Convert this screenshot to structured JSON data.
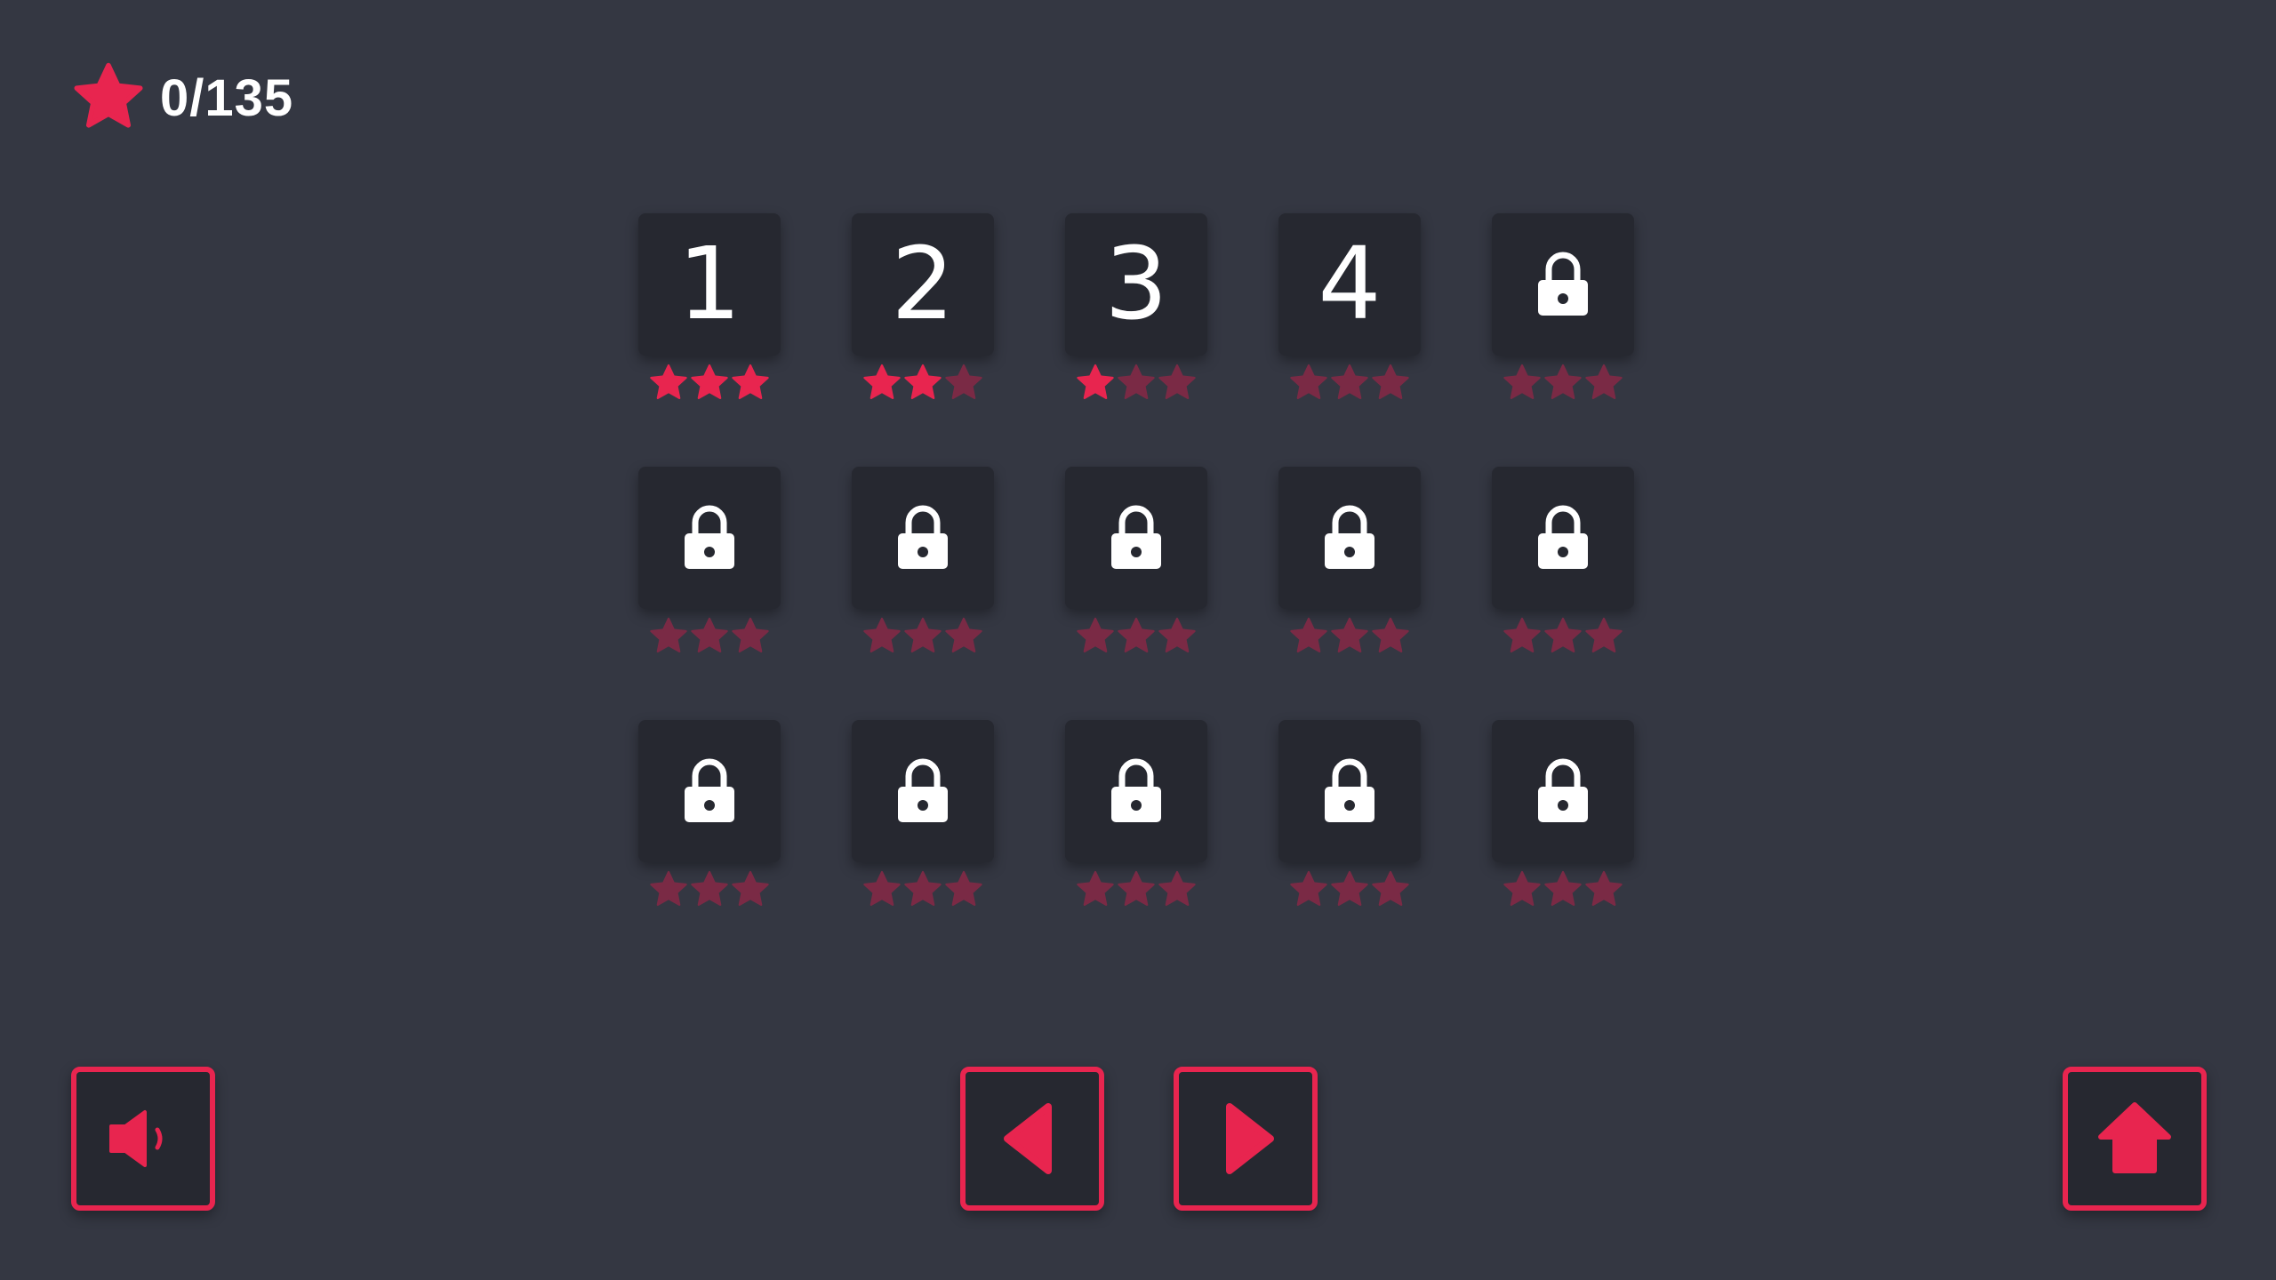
{
  "header": {
    "star_icon": "star-icon",
    "stars_collected": "0/135"
  },
  "colors": {
    "accent": "#e8254f",
    "star_dim": "#7a2a45",
    "background": "#343742",
    "tile": "#262830",
    "text": "#ffffff"
  },
  "levels": [
    {
      "label": "1",
      "locked": false,
      "stars": 3
    },
    {
      "label": "2",
      "locked": false,
      "stars": 2
    },
    {
      "label": "3",
      "locked": false,
      "stars": 1
    },
    {
      "label": "4",
      "locked": false,
      "stars": 0
    },
    {
      "label": "",
      "locked": true,
      "stars": 0
    },
    {
      "label": "",
      "locked": true,
      "stars": 0
    },
    {
      "label": "",
      "locked": true,
      "stars": 0
    },
    {
      "label": "",
      "locked": true,
      "stars": 0
    },
    {
      "label": "",
      "locked": true,
      "stars": 0
    },
    {
      "label": "",
      "locked": true,
      "stars": 0
    },
    {
      "label": "",
      "locked": true,
      "stars": 0
    },
    {
      "label": "",
      "locked": true,
      "stars": 0
    },
    {
      "label": "",
      "locked": true,
      "stars": 0
    },
    {
      "label": "",
      "locked": true,
      "stars": 0
    },
    {
      "label": "",
      "locked": true,
      "stars": 0
    }
  ],
  "controls": {
    "sound_icon": "speaker-icon",
    "prev_icon": "arrow-left-icon",
    "next_icon": "arrow-right-icon",
    "home_icon": "home-icon"
  }
}
